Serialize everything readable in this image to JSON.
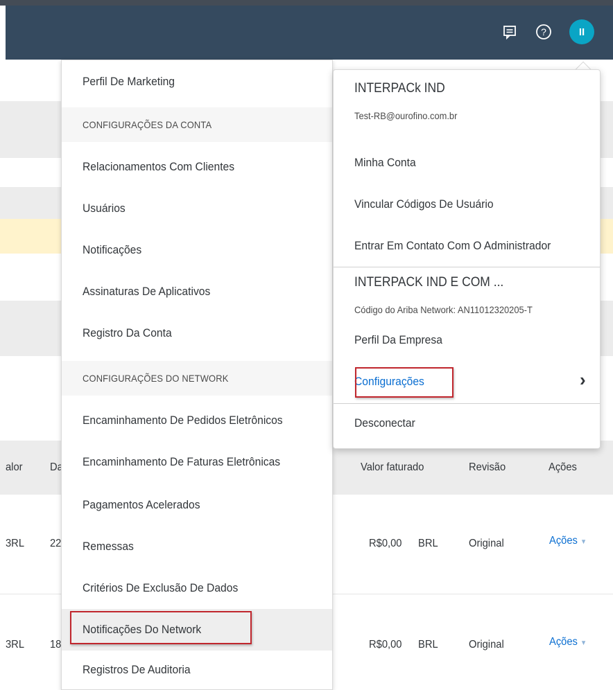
{
  "header": {
    "icons": [
      "feedback-icon",
      "help-icon"
    ],
    "avatar_initials": "II"
  },
  "table": {
    "columns": {
      "valor": "alor",
      "data": "Da",
      "valor_faturado": "Valor faturado",
      "revisao": "Revisão",
      "acoes": "Ações"
    },
    "rows": [
      {
        "currency_left": "3RL",
        "date_fragment": "22",
        "amount": "R$0,00",
        "currency": "BRL",
        "revision": "Original",
        "actions": "Ações"
      },
      {
        "currency_left": "3RL",
        "date_fragment": "18",
        "amount": "R$0,00",
        "currency": "BRL",
        "revision": "Original",
        "actions": "Ações"
      }
    ]
  },
  "settings_menu": {
    "items": [
      {
        "label": "Perfil De Marketing",
        "type": "item"
      },
      {
        "label": "CONFIGURAÇÕES DA CONTA",
        "type": "section"
      },
      {
        "label": "Relacionamentos Com Clientes",
        "type": "item"
      },
      {
        "label": "Usuários",
        "type": "item"
      },
      {
        "label": "Notificações",
        "type": "item"
      },
      {
        "label": "Assinaturas De Aplicativos",
        "type": "item"
      },
      {
        "label": "Registro Da Conta",
        "type": "item"
      },
      {
        "label": "CONFIGURAÇÕES DO NETWORK",
        "type": "section"
      },
      {
        "label": "Encaminhamento De Pedidos Eletrônicos",
        "type": "item"
      },
      {
        "label": "Encaminhamento De Faturas Eletrônicas",
        "type": "item"
      },
      {
        "label": "Pagamentos Acelerados",
        "type": "item"
      },
      {
        "label": "Remessas",
        "type": "item"
      },
      {
        "label": "Critérios De Exclusão De Dados",
        "type": "item"
      },
      {
        "label": "Notificações Do Network",
        "type": "item",
        "highlighted": true
      },
      {
        "label": "Registros De Auditoria",
        "type": "item"
      }
    ]
  },
  "account_menu": {
    "user_company": "INTERPACk IND",
    "user_email": "Test-RB@ourofino.com.br",
    "minha_conta": "Minha Conta",
    "vincular": "Vincular Códigos De Usuário",
    "contato_admin": "Entrar Em Contato Com O Administrador",
    "company_name": "INTERPACK IND E COM ...",
    "network_code": "Código do Ariba Network: AN11012320205-T",
    "perfil_empresa": "Perfil Da Empresa",
    "configuracoes": "Configurações",
    "chevron": "›",
    "desconectar": "Desconectar"
  },
  "colors": {
    "header": "#354a5f",
    "avatar": "#0aa5c5",
    "link": "#0a6ed1",
    "highlight_box": "#c0262d"
  }
}
